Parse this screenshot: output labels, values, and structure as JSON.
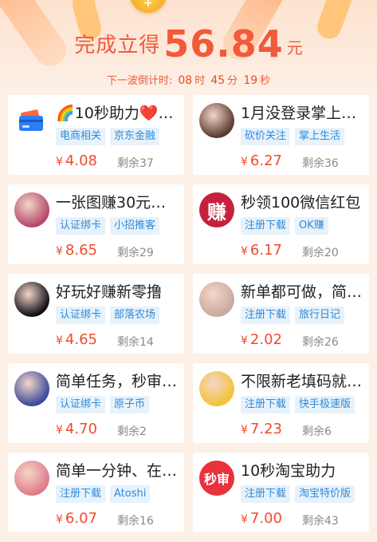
{
  "header": {
    "prefix": "完成立得",
    "amount": "56.84",
    "unit": "元",
    "countdown_label": "下一波倒计时:",
    "hours": "08",
    "hours_unit": "时",
    "minutes": "45",
    "minutes_unit": "分",
    "seconds": "19",
    "seconds_unit": "秒"
  },
  "currency_symbol": "¥",
  "tasks": [
    {
      "title": "🌈10秒助力❤️…",
      "tags": [
        "电商相关",
        "京东金融"
      ],
      "price": "4.08",
      "remaining": "剩余37",
      "avatar": "card-icon",
      "avatar_color": "#2e7cf6"
    },
    {
      "title": "1月没登录掌上…",
      "tags": [
        "砍价关注",
        "掌上生活"
      ],
      "price": "6.27",
      "remaining": "剩余36",
      "avatar": "portrait-photo",
      "avatar_color": "#5a3b33"
    },
    {
      "title": "一张图赚30元…",
      "tags": [
        "认证绑卡",
        "小招推客"
      ],
      "price": "8.65",
      "remaining": "剩余29",
      "avatar": "anime-photo",
      "avatar_color": "#b5476a"
    },
    {
      "title": "秒领100微信红包",
      "tags": [
        "注册下载",
        "OK赚"
      ],
      "price": "6.17",
      "remaining": "剩余20",
      "avatar": "zhuan-logo",
      "avatar_color": "#c6213c",
      "avatar_text": "赚"
    },
    {
      "title": "好玩好赚新零撸",
      "tags": [
        "认证绑卡",
        "部落农场"
      ],
      "price": "4.65",
      "remaining": "剩余14",
      "avatar": "night-photo",
      "avatar_color": "#101018"
    },
    {
      "title": "新单都可做，简…",
      "tags": [
        "注册下载",
        "旅行日记"
      ],
      "price": "2.02",
      "remaining": "剩余26",
      "avatar": "doll-photo",
      "avatar_color": "#c9a9a0"
    },
    {
      "title": "简单任务，秒审…",
      "tags": [
        "认证绑卡",
        "原子币"
      ],
      "price": "4.70",
      "remaining": "剩余2",
      "avatar": "cartoon-photo",
      "avatar_color": "#3b4a9a"
    },
    {
      "title": "不限新老填码就…",
      "tags": [
        "注册下载",
        "快手极速版"
      ],
      "price": "7.23",
      "remaining": "剩余6",
      "avatar": "glasses-girl-photo",
      "avatar_color": "#f2c33a"
    },
    {
      "title": "简单一分钟、在…",
      "tags": [
        "注册下载",
        "Atoshi"
      ],
      "price": "6.07",
      "remaining": "剩余16",
      "avatar": "girl-photo",
      "avatar_color": "#e07a8a"
    },
    {
      "title": "10秒淘宝助力",
      "tags": [
        "注册下载",
        "淘宝特价版"
      ],
      "price": "7.00",
      "remaining": "剩余43",
      "avatar": "miaoshen-logo",
      "avatar_color": "#e8323c",
      "avatar_text": "秒审"
    }
  ]
}
